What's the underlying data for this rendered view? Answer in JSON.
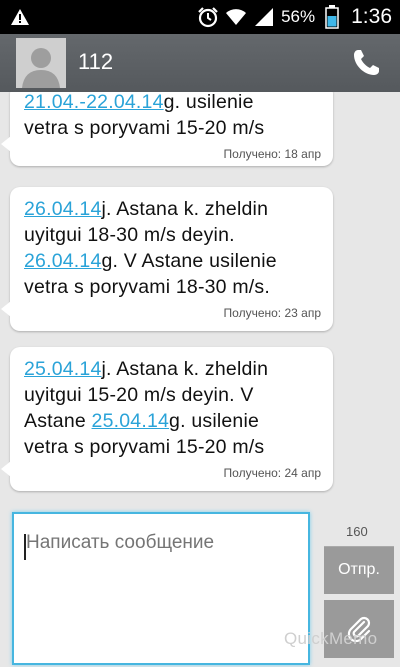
{
  "status_bar": {
    "battery_percent": "56%",
    "time": "1:36",
    "icons": [
      "warning-icon",
      "alarm-icon",
      "wifi-icon",
      "signal-icon",
      "battery-icon"
    ]
  },
  "header": {
    "contact": "112",
    "avatar_icon": "person-icon",
    "call_icon": "phone-icon"
  },
  "messages": [
    {
      "segments": [
        {
          "text": "21.04.-22.04.14",
          "link": true
        },
        {
          "text": "g. usilenie vetra s poryvami 15-20 m/s",
          "link": false
        }
      ],
      "line1_tail": "g. usilenie",
      "line2": "vetra s poryvami 15-20 m/s",
      "received": "Получено: 18 апр"
    },
    {
      "l1_link": "26.04.14",
      "l1_tail": "j. Astana k. zheldin",
      "l2": "uyitgui 18-30 m/s deyin.",
      "l3_link": "26.04.14",
      "l3_tail": "g. V Astane usilenie",
      "l4": "vetra s poryvami 18-30 m/s.",
      "received": "Получено: 23 апр"
    },
    {
      "l1_link": "25.04.14",
      "l1_tail": "j. Astana k. zheldin",
      "l2": "uyitgui 15-20 m/s deyin. V",
      "l3_head": "Astane ",
      "l3_link": "25.04.14",
      "l3_tail": "g. usilenie",
      "l4": "vetra s poryvami 15-20 m/s",
      "received": "Получено: 24 апр"
    }
  ],
  "compose": {
    "placeholder": "Написать сообщение",
    "char_counter": "160",
    "send_label": "Отпр.",
    "attach_icon": "paperclip-icon",
    "watermark": "QuickMemo"
  },
  "colors": {
    "link": "#2aa3d8",
    "input_focus": "#46b6e0",
    "action_bar": "#5b5f63"
  }
}
